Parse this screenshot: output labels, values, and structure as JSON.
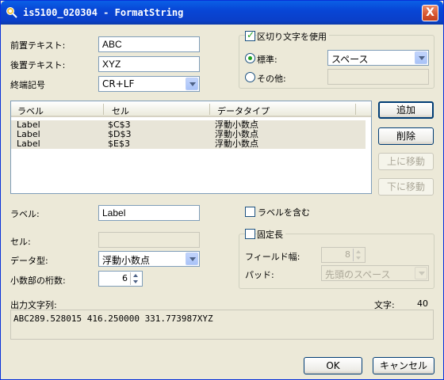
{
  "window": {
    "title": "is5100_020304 - FormatString",
    "close_glyph": "X",
    "icon": "app-icon"
  },
  "fields": {
    "prefix_label": "前置テキスト:",
    "prefix_value": "ABC",
    "suffix_label": "後置テキスト:",
    "suffix_value": "XYZ",
    "terminator_label": "終端記号",
    "terminator_value": "CR+LF"
  },
  "delimiter": {
    "use_label": "区切り文字を使用",
    "use_checked": true,
    "standard_label": "標準:",
    "standard_selected": true,
    "standard_value": "スペース",
    "other_label": "その他:",
    "other_value": ""
  },
  "table": {
    "headers": [
      "ラベル",
      "セル",
      "データタイプ"
    ],
    "rows": [
      [
        "Label",
        "$C$3",
        "浮動小数点"
      ],
      [
        "Label",
        "$D$3",
        "浮動小数点"
      ],
      [
        "Label",
        "$E$3",
        "浮動小数点"
      ]
    ]
  },
  "side_buttons": {
    "add": "追加",
    "delete": "削除",
    "move_up": "上に移動",
    "move_down": "下に移動"
  },
  "detail": {
    "label_label": "ラベル:",
    "label_value": "Label",
    "cell_label": "セル:",
    "cell_value": "",
    "datatype_label": "データ型:",
    "datatype_value": "浮動小数点",
    "decimals_label": "小数部の桁数:",
    "decimals_value": "6",
    "include_label_text": "ラベルを含む",
    "include_label_checked": false,
    "fixed_length_text": "固定長",
    "fixed_length_checked": false,
    "field_width_label": "フィールド幅:",
    "field_width_value": "8",
    "pad_label": "パッド:",
    "pad_value": "先頭のスペース"
  },
  "output": {
    "label": "出力文字列:",
    "chars_label": "文字:",
    "chars_count": "40",
    "value": "ABC289.528015 416.250000 331.773987XYZ"
  },
  "footer": {
    "ok": "OK",
    "cancel": "キャンセル"
  },
  "colors": {
    "titlebar": "#0a5fe6",
    "dialog_bg": "#ece9d8",
    "check_green": "#21a121"
  }
}
